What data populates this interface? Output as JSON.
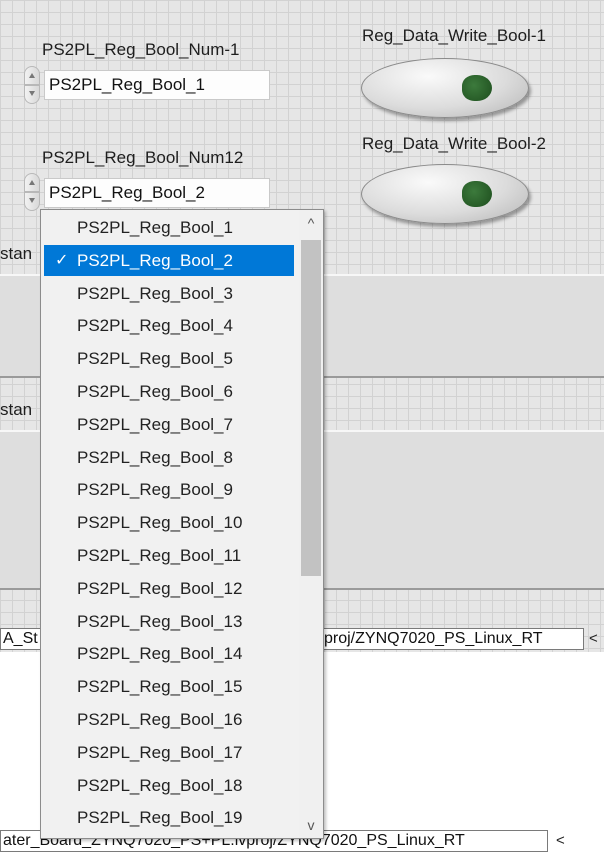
{
  "controls": {
    "ring1": {
      "label": "PS2PL_Reg_Bool_Num-1",
      "value": "PS2PL_Reg_Bool_1"
    },
    "ring2": {
      "label": "PS2PL_Reg_Bool_Num12",
      "value": "PS2PL_Reg_Bool_2"
    },
    "button1": {
      "label": "Reg_Data_Write_Bool-1"
    },
    "button2": {
      "label": "Reg_Data_Write_Bool-2"
    }
  },
  "frames": {
    "frame1_label": "stan",
    "frame2_label": "stan"
  },
  "status": {
    "path1_prefix": "A_St",
    "path1_suffix": "proj/ZYNQ7020_PS_Linux_RT",
    "path2": "ater_Board_ZYNQ7020_PS+PL.lvproj/ZYNQ7020_PS_Linux_RT",
    "scroll_glyph": "<"
  },
  "dropdown": {
    "check_mark": "✓",
    "selected_index": 1,
    "items": [
      "PS2PL_Reg_Bool_1",
      "PS2PL_Reg_Bool_2",
      "PS2PL_Reg_Bool_3",
      "PS2PL_Reg_Bool_4",
      "PS2PL_Reg_Bool_5",
      "PS2PL_Reg_Bool_6",
      "PS2PL_Reg_Bool_7",
      "PS2PL_Reg_Bool_8",
      "PS2PL_Reg_Bool_9",
      "PS2PL_Reg_Bool_10",
      "PS2PL_Reg_Bool_11",
      "PS2PL_Reg_Bool_12",
      "PS2PL_Reg_Bool_13",
      "PS2PL_Reg_Bool_14",
      "PS2PL_Reg_Bool_15",
      "PS2PL_Reg_Bool_16",
      "PS2PL_Reg_Bool_17",
      "PS2PL_Reg_Bool_18",
      "PS2PL_Reg_Bool_19"
    ],
    "scroll_up": "^",
    "scroll_down": "v"
  },
  "colors": {
    "selection": "#0078d7",
    "led_green": "#2d6a2d",
    "panel_grid": "#e6e6e6"
  }
}
